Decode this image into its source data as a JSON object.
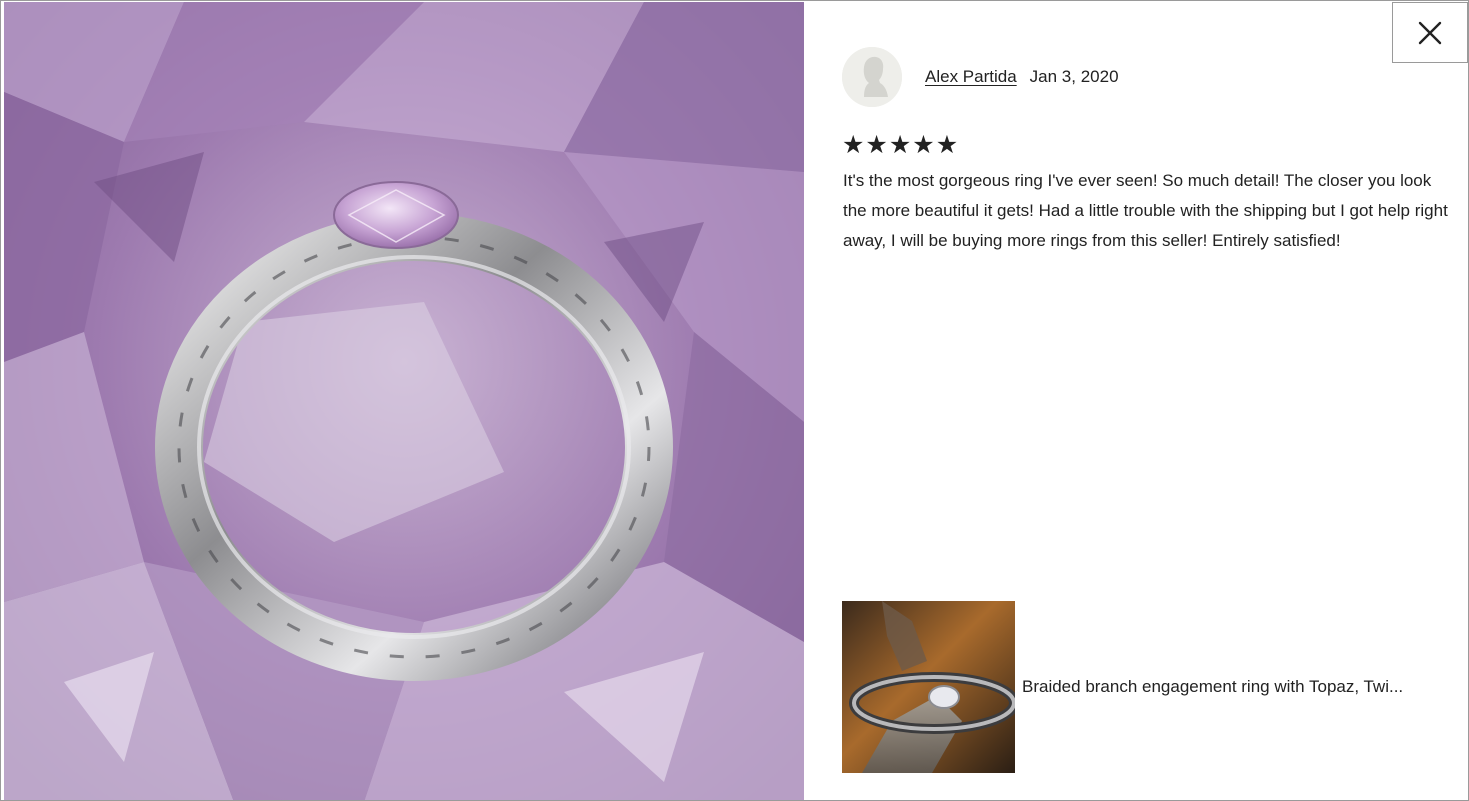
{
  "review": {
    "reviewer_name": "Alex Partida",
    "date": "Jan 3, 2020",
    "rating": 5,
    "stars": [
      "★",
      "★",
      "★",
      "★",
      "★"
    ],
    "text": "It's the most gorgeous ring I've ever seen! So much detail! The closer you look the more beautiful it gets! Had a little trouble with the shipping but I got help right away, I will be buying more rings from this seller! Entirely satisfied!"
  },
  "product": {
    "title": "Braided branch engagement ring with Topaz, Twi..."
  },
  "close": {
    "label": "×"
  },
  "icons": {
    "close": "close-icon",
    "avatar": "user-silhouette-icon",
    "star": "star-icon"
  },
  "colors": {
    "text": "#222222",
    "border": "#9a9a9a",
    "amethyst": "#a585b4"
  }
}
